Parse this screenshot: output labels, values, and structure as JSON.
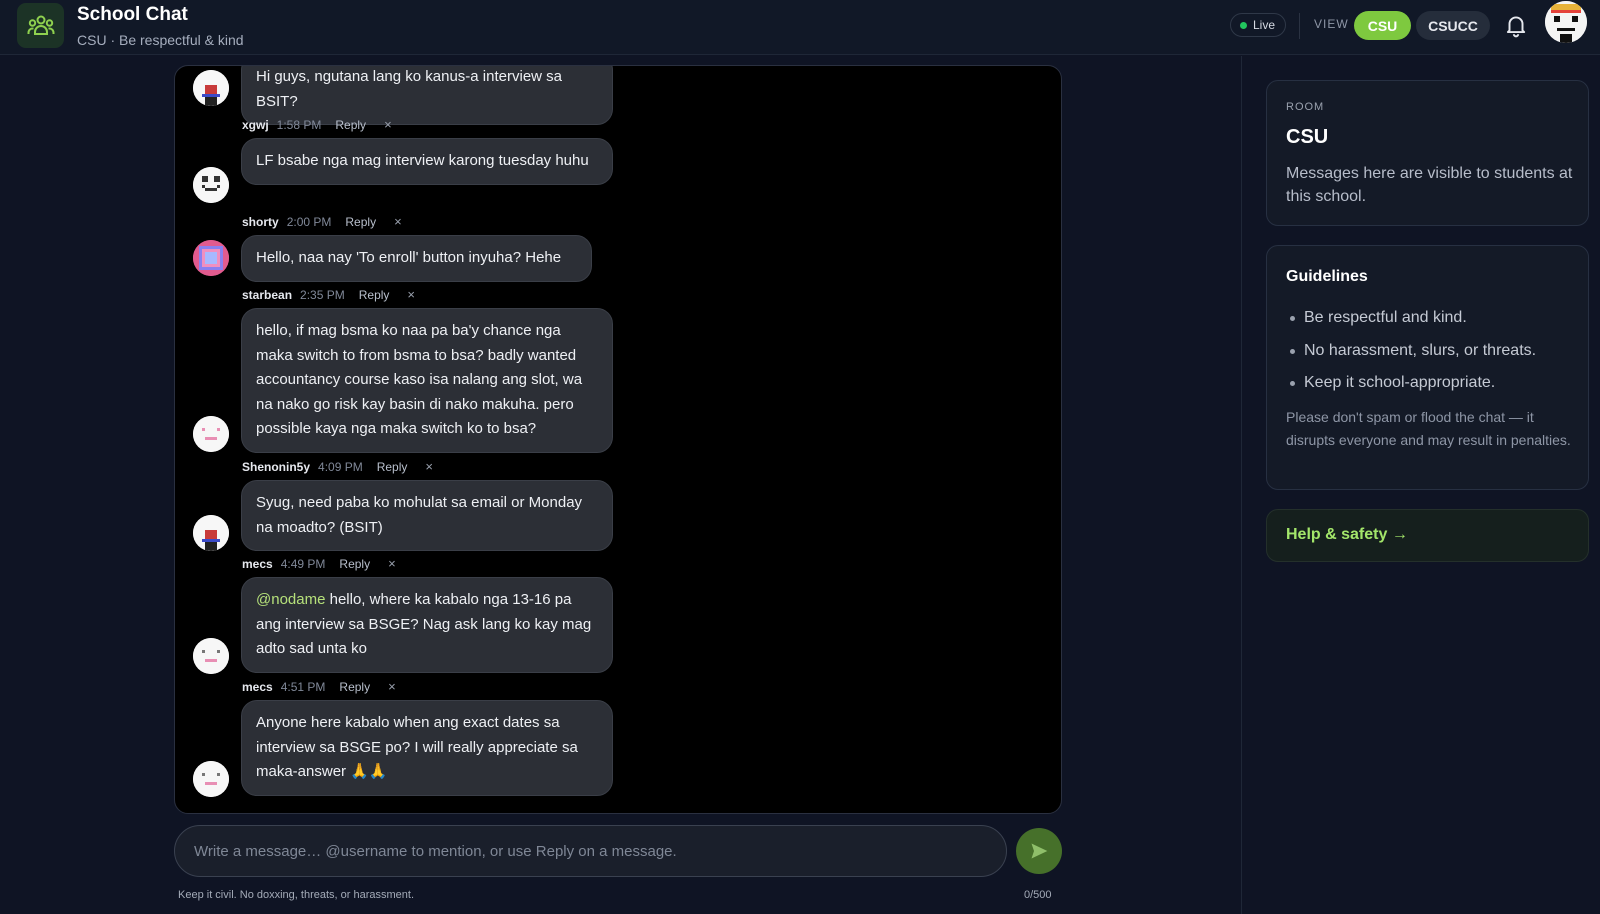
{
  "header": {
    "title": "School Chat",
    "subtitle": "CSU · Be respectful & kind",
    "live_label": "Live",
    "view_label": "VIEW",
    "view_options": [
      "CSU",
      "CSUCC"
    ],
    "active_view": "CSU"
  },
  "messages": [
    {
      "text": "Hi guys, ngutana lang ko kanus-a interview sa BSIT?",
      "user": "xgwj",
      "time": "1:58 PM"
    },
    {
      "text": "LF bsabe nga mag interview karong tuesday huhu",
      "user": "shorty",
      "time": "2:00 PM"
    },
    {
      "text": "Hello, naa nay 'To enroll' button inyuha? Hehe",
      "user": "starbean",
      "time": "2:35 PM"
    },
    {
      "text": "hello, if mag bsma ko naa pa ba'y chance nga maka switch to from bsma to bsa? badly wanted accountancy course kaso isa nalang ang slot, wa na nako go risk kay basin di nako makuha. pero possible kaya nga maka switch ko to bsa?",
      "user": "Shenonin5y",
      "time": "4:09 PM"
    },
    {
      "text": "Syug, need paba ko mohulat sa email or Monday na moadto? (BSIT)",
      "user": "mecs",
      "time": "4:49 PM"
    },
    {
      "mention": "@nodame",
      "text": " hello, where ka kabalo nga 13-16 pa ang interview sa BSGE? Nag ask lang ko kay mag adto sad unta ko",
      "user": "mecs",
      "time": "4:51 PM"
    },
    {
      "text": "Anyone here kabalo when ang exact dates sa interview sa BSGE po? I will really appreciate sa maka-answer 🙏🙏"
    }
  ],
  "reply_label": "Reply",
  "dismiss_label": "×",
  "composer": {
    "placeholder": "Write a message… @username to mention, or use Reply on a message.",
    "hint": "Keep it civil. No doxxing, threats, or harassment.",
    "counter": "0/500"
  },
  "sidebar": {
    "room_label": "ROOM",
    "room_name": "CSU",
    "room_desc": "Messages here are visible to students at this school.",
    "guidelines_title": "Guidelines",
    "guidelines": [
      "Be respectful and kind.",
      "No harassment, slurs, or threats.",
      "Keep it school-appropriate."
    ],
    "guidelines_note": "Please don't spam or flood the chat — it disrupts everyone and may result in penalties.",
    "help_link": "Help & safety →"
  },
  "colors": {
    "accent": "#7ec93f",
    "live_dot": "#22c55e",
    "mention": "#b5e07a",
    "help_link": "#a3e66a"
  }
}
